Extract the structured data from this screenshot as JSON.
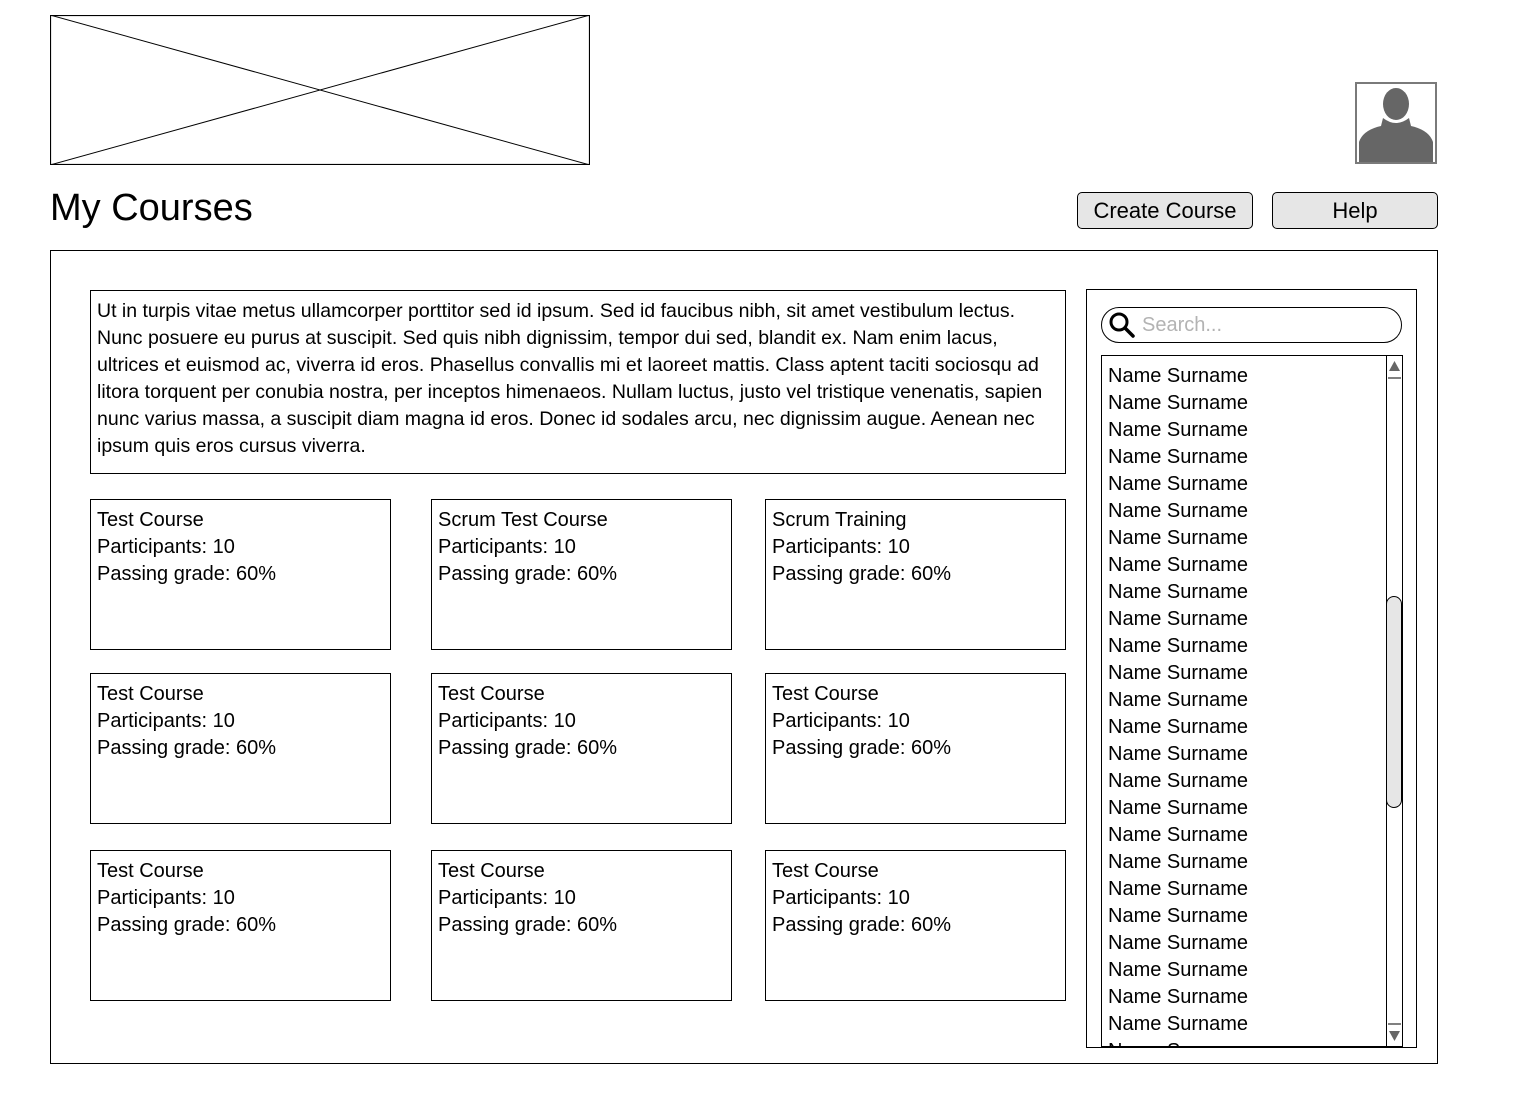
{
  "header": {
    "logo_icon": "image-placeholder-icon",
    "avatar_icon": "user-avatar-icon",
    "title": "My Courses",
    "create_course_label": "Create Course",
    "help_label": "Help"
  },
  "main": {
    "description": "Ut in turpis vitae metus ullamcorper porttitor sed id ipsum. Sed id faucibus nibh, sit amet vestibulum lectus. Nunc posuere eu purus at suscipit. Sed quis nibh dignissim, tempor dui sed, blandit ex. Nam enim lacus, ultrices et euismod ac, viverra id eros. Phasellus convallis mi et laoreet mattis. Class aptent taciti sociosqu ad litora torquent per conubia nostra, per inceptos himenaeos. Nullam luctus, justo vel tristique venenatis, sapien nunc varius massa, a suscipit diam magna id eros. Donec id sodales arcu, nec dignissim augue. Aenean nec ipsum quis eros cursus viverra.",
    "courses": [
      {
        "name": "Test Course",
        "participants": "Participants: 10",
        "grade": "Passing grade: 60%"
      },
      {
        "name": "Scrum Test Course",
        "participants": "Participants: 10",
        "grade": "Passing grade: 60%"
      },
      {
        "name": "Scrum Training",
        "participants": "Participants: 10",
        "grade": "Passing grade: 60%"
      },
      {
        "name": "Test Course",
        "participants": "Participants: 10",
        "grade": "Passing grade: 60%"
      },
      {
        "name": "Test Course",
        "participants": "Participants: 10",
        "grade": "Passing grade: 60%"
      },
      {
        "name": "Test Course",
        "participants": "Participants: 10",
        "grade": "Passing grade: 60%"
      },
      {
        "name": "Test Course",
        "participants": "Participants: 10",
        "grade": "Passing grade: 60%"
      },
      {
        "name": "Test Course",
        "participants": "Participants: 10",
        "grade": "Passing grade: 60%"
      },
      {
        "name": "Test Course",
        "participants": "Participants: 10",
        "grade": "Passing grade: 60%"
      }
    ]
  },
  "sidebar": {
    "search_placeholder": "Search...",
    "search_icon": "search-icon",
    "users": [
      "Name Surname",
      "Name Surname",
      "Name Surname",
      "Name Surname",
      "Name Surname",
      "Name Surname",
      "Name Surname",
      "Name Surname",
      "Name Surname",
      "Name Surname",
      "Name Surname",
      "Name Surname",
      "Name Surname",
      "Name Surname",
      "Name Surname",
      "Name Surname",
      "Name Surname",
      "Name Surname",
      "Name Surname",
      "Name Surname",
      "Name Surname",
      "Name Surname",
      "Name Surname",
      "Name Surname",
      "Name Surname",
      "Name Surname"
    ]
  }
}
